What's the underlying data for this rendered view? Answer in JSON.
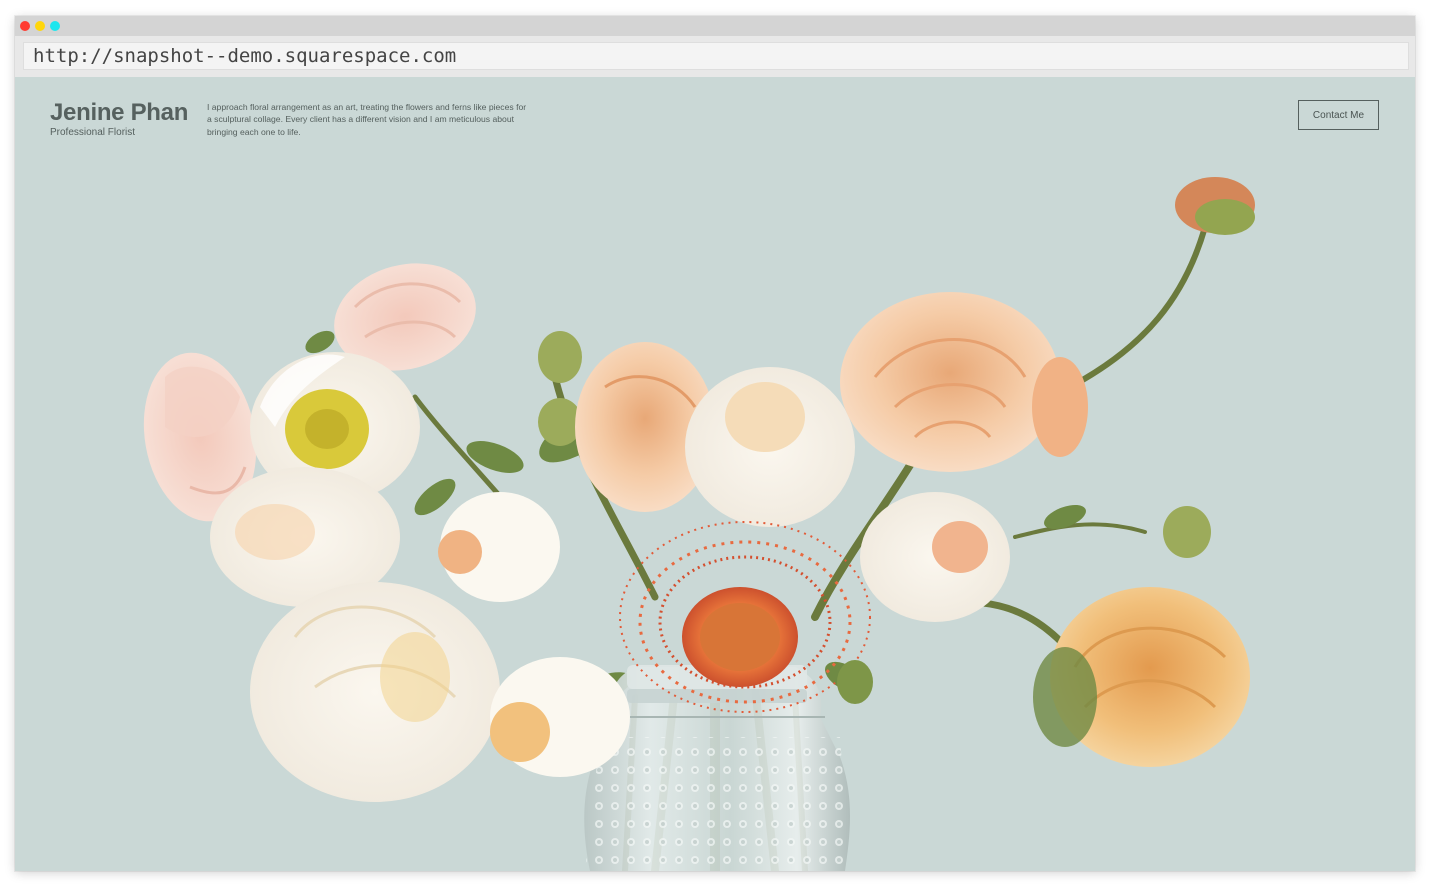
{
  "browser": {
    "url": "http://snapshot--demo.squarespace.com",
    "traffic_lights": {
      "close_color": "#ff3b30",
      "minimize_color": "#ffd60a",
      "zoom_color": "#1ce6ee"
    }
  },
  "site": {
    "brand_name": "Jenine Phan",
    "brand_tagline": "Professional Florist",
    "intro_text": "I approach floral arrangement as an art, treating the flowers and ferns like pieces for a sculptural collage. Every client has a different vision and I am meticulous about bringing each one to life.",
    "contact_button_label": "Contact Me",
    "background_color": "#cad8d6",
    "text_color": "#55605e"
  },
  "hero_image": {
    "subject": "bouquet-in-glass-jar-icon"
  }
}
